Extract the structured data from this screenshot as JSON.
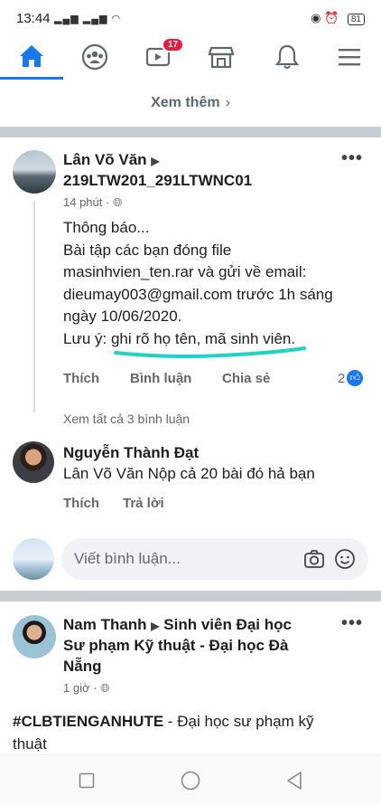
{
  "status": {
    "time": "13:44",
    "battery": "81"
  },
  "nav": {
    "watch_badge": "17"
  },
  "see_more": "Xem thêm",
  "post1": {
    "author": "Lân Võ Văn",
    "group": "219LTW201_291LTWNC01",
    "time": "14 phút ·",
    "lines": [
      "Thông báo...",
      "Bài tập các bạn đóng file",
      "masinhvien_ten.rar và gửi về email:",
      "dieumay003@gmail.com trước 1h sáng",
      "ngày 10/06/2020.",
      "Lưu ý: ghi rõ họ tên, mã sinh viên."
    ],
    "like": "Thích",
    "comment": "Bình luận",
    "share": "Chia sẻ",
    "reactions": "2",
    "view_all": "Xem tất cả 3 bình luận"
  },
  "comment1": {
    "author": "Nguyễn Thành Đạt",
    "mention": "Lân Võ Văn",
    "text": " Nộp cả 20 bài đó hả bạn",
    "like": "Thích",
    "reply": "Trả lời"
  },
  "comment_input": {
    "placeholder": "Viết bình luận..."
  },
  "post2": {
    "author": "Nam Thanh",
    "group_line1": "Sinh viên Đại học",
    "group_line2": "Sư phạm Kỹ thuật - Đại học Đà",
    "group_line3": "Nẵng",
    "time": "1 giờ ·",
    "hashtag": "#CLBTIENGANHUTE",
    "text1": " -  Đại học sư phạm kỹ",
    "text2": "thuật"
  }
}
